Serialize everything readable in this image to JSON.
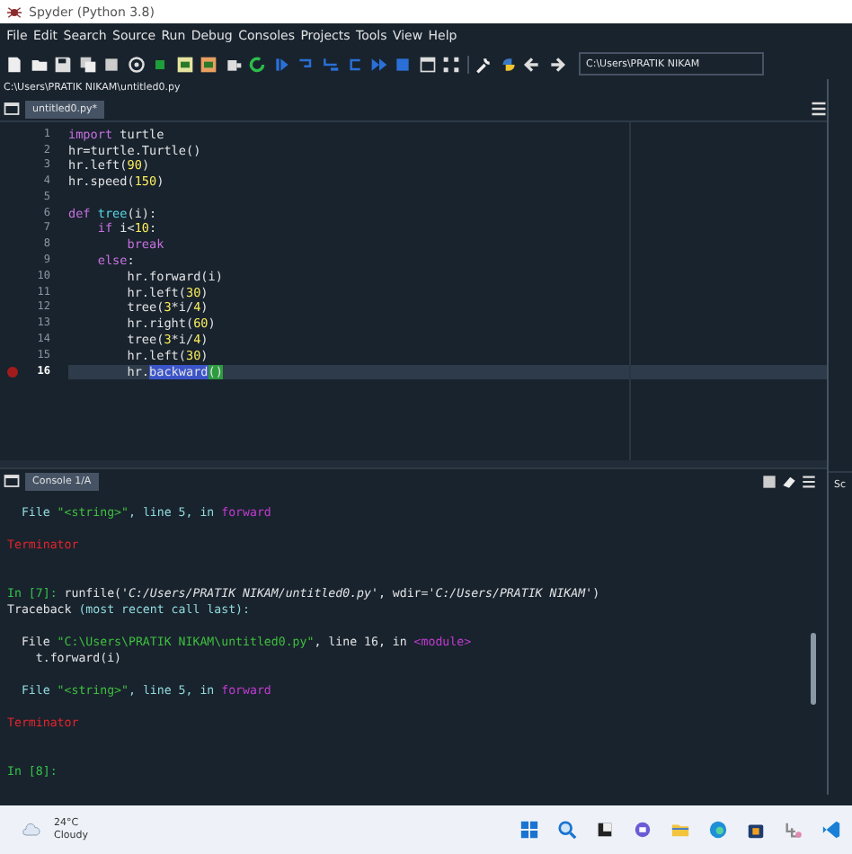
{
  "window": {
    "title": "Spyder (Python 3.8)"
  },
  "menu": [
    "File",
    "Edit",
    "Search",
    "Source",
    "Run",
    "Debug",
    "Consoles",
    "Projects",
    "Tools",
    "View",
    "Help"
  ],
  "toolbar": {
    "path": "C:\\Users\\PRATIK NIKAM"
  },
  "editor": {
    "file_path": "C:\\Users\\PRATIK NIKAM\\untitled0.py",
    "tabs": [
      {
        "label": "untitled0.py*",
        "selected": true
      }
    ],
    "lines": [
      {
        "number": "1",
        "breakpoint": false,
        "current": false,
        "tokens": [
          {
            "kind": "keyword",
            "text": "import"
          },
          {
            "kind": "name",
            "text": " turtle"
          }
        ]
      },
      {
        "number": "2",
        "breakpoint": false,
        "current": false,
        "tokens": [
          {
            "kind": "name",
            "text": "hr=turtle.Turtle()"
          }
        ]
      },
      {
        "number": "3",
        "breakpoint": false,
        "current": false,
        "tokens": [
          {
            "kind": "name",
            "text": "hr.left("
          },
          {
            "kind": "number",
            "text": "90"
          },
          {
            "kind": "name",
            "text": ")"
          }
        ]
      },
      {
        "number": "4",
        "breakpoint": false,
        "current": false,
        "tokens": [
          {
            "kind": "name",
            "text": "hr.speed("
          },
          {
            "kind": "number",
            "text": "150"
          },
          {
            "kind": "name",
            "text": ")"
          }
        ]
      },
      {
        "number": "5",
        "breakpoint": false,
        "current": false
      },
      {
        "number": "6",
        "breakpoint": false,
        "current": false,
        "tokens": [
          {
            "kind": "keyword",
            "text": "def"
          },
          {
            "kind": "definition",
            "text": " tree"
          },
          {
            "kind": "name",
            "text": "(i):"
          }
        ]
      },
      {
        "number": "7",
        "breakpoint": false,
        "current": false,
        "tokens": [
          {
            "kind": "keyword",
            "text": "    if"
          },
          {
            "kind": "name",
            "text": " i<"
          },
          {
            "kind": "number",
            "text": "10"
          },
          {
            "kind": "name",
            "text": ":"
          }
        ]
      },
      {
        "number": "8",
        "breakpoint": false,
        "current": false,
        "tokens": [
          {
            "kind": "keyword",
            "text": "        break"
          }
        ]
      },
      {
        "number": "9",
        "breakpoint": false,
        "current": false,
        "tokens": [
          {
            "kind": "keyword",
            "text": "    else"
          },
          {
            "kind": "name",
            "text": ":"
          }
        ]
      },
      {
        "number": "10",
        "breakpoint": false,
        "current": false,
        "tokens": [
          {
            "kind": "name",
            "text": "        hr.forward(i)"
          }
        ]
      },
      {
        "number": "11",
        "breakpoint": false,
        "current": false,
        "tokens": [
          {
            "kind": "name",
            "text": "        hr.left("
          },
          {
            "kind": "number",
            "text": "30"
          },
          {
            "kind": "name",
            "text": ")"
          }
        ]
      },
      {
        "number": "12",
        "breakpoint": false,
        "current": false,
        "tokens": [
          {
            "kind": "name",
            "text": "        tree("
          },
          {
            "kind": "number",
            "text": "3"
          },
          {
            "kind": "name",
            "text": "*i/"
          },
          {
            "kind": "number",
            "text": "4"
          },
          {
            "kind": "name",
            "text": ")"
          }
        ]
      },
      {
        "number": "13",
        "breakpoint": false,
        "current": false,
        "tokens": [
          {
            "kind": "name",
            "text": "        hr.right("
          },
          {
            "kind": "number",
            "text": "60"
          },
          {
            "kind": "name",
            "text": ")"
          }
        ]
      },
      {
        "number": "14",
        "breakpoint": false,
        "current": false,
        "tokens": [
          {
            "kind": "name",
            "text": "        tree("
          },
          {
            "kind": "number",
            "text": "3"
          },
          {
            "kind": "name",
            "text": "*i/"
          },
          {
            "kind": "number",
            "text": "4"
          },
          {
            "kind": "name",
            "text": ")"
          }
        ]
      },
      {
        "number": "15",
        "breakpoint": false,
        "current": false,
        "tokens": [
          {
            "kind": "name",
            "text": "        hr.left("
          },
          {
            "kind": "number",
            "text": "30"
          },
          {
            "kind": "name",
            "text": ")"
          }
        ]
      },
      {
        "number": "16",
        "breakpoint": true,
        "current": true,
        "tokens": [
          {
            "kind": "name",
            "text": "        hr."
          },
          {
            "kind": "occurrence",
            "text": "backward"
          },
          {
            "kind": "match",
            "text": "()"
          }
        ]
      }
    ]
  },
  "console": {
    "tabs": [
      {
        "label": "Console 1/A",
        "selected": true
      }
    ],
    "blocks": [
      {
        "kind": "output",
        "lines": [
          [
            {
              "kind": "frame",
              "text": "  File "
            },
            {
              "kind": "string",
              "text": "\"<string>\""
            },
            {
              "kind": "frame",
              "text": ", line 5, in "
            },
            {
              "kind": "function",
              "text": "forward"
            }
          ]
        ]
      },
      {
        "kind": "error",
        "lines": [
          [
            {
              "kind": "error",
              "text": "Terminator"
            }
          ]
        ]
      },
      {
        "kind": "output",
        "lines": [
          [
            {
              "kind": "prompt",
              "text": "In [7]: "
            },
            {
              "kind": "plain",
              "text": "runfile("
            },
            {
              "kind": "path",
              "text": "'C:/Users/PRATIK NIKAM/untitled0.py'"
            },
            {
              "kind": "plain",
              "text": ", wdir="
            },
            {
              "kind": "path",
              "text": "'C:/Users/PRATIK NIKAM'"
            },
            {
              "kind": "plain",
              "text": ")"
            }
          ],
          [
            {
              "kind": "plain",
              "text": "Traceback "
            },
            {
              "kind": "frame",
              "text": "(most recent call last):"
            }
          ]
        ]
      },
      {
        "kind": "output",
        "lines": [
          [
            {
              "kind": "plain",
              "text": "  File "
            },
            {
              "kind": "string",
              "text": "\"C:\\Users\\PRATIK NIKAM\\untitled0.py\""
            },
            {
              "kind": "plain",
              "text": ", line 16, in "
            },
            {
              "kind": "function",
              "text": "<module>"
            }
          ],
          [
            {
              "kind": "plain",
              "text": "    t.forward(i)"
            }
          ]
        ]
      },
      {
        "kind": "output",
        "lines": [
          [
            {
              "kind": "frame",
              "text": "  File "
            },
            {
              "kind": "string",
              "text": "\"<string>\""
            },
            {
              "kind": "frame",
              "text": ", line 5, in "
            },
            {
              "kind": "function",
              "text": "forward"
            }
          ]
        ]
      },
      {
        "kind": "error",
        "lines": [
          [
            {
              "kind": "error",
              "text": "Terminator"
            }
          ]
        ]
      },
      {
        "kind": "output",
        "lines": [
          [
            {
              "kind": "prompt",
              "text": "In [8]:"
            }
          ]
        ]
      }
    ]
  },
  "side_pane": {
    "tab": "Sc"
  },
  "taskbar": {
    "temperature": "24°C",
    "weather": "Cloudy"
  }
}
